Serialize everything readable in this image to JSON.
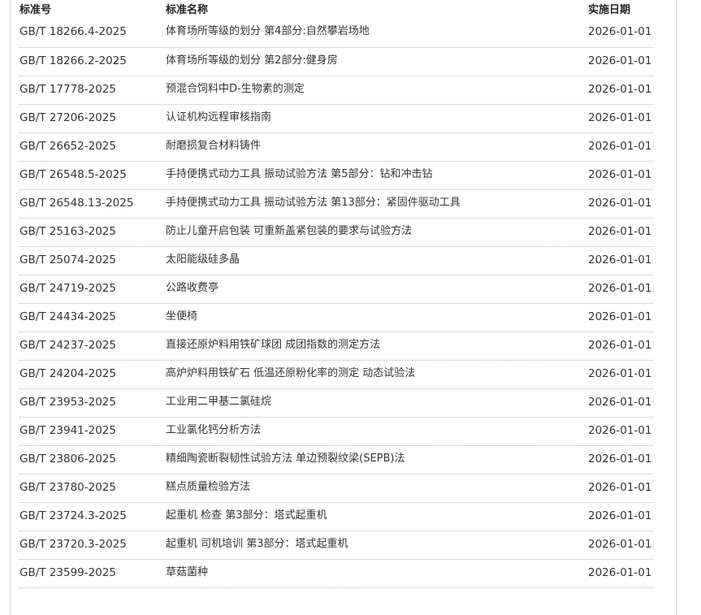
{
  "table": {
    "headers": {
      "code": "标准号",
      "name": "标准名称",
      "date": "实施日期"
    },
    "rows": [
      {
        "code": "GB/T 18266.4-2025",
        "name": "体育场所等级的划分 第4部分:自然攀岩场地",
        "date": "2026-01-01"
      },
      {
        "code": "GB/T 18266.2-2025",
        "name": "体育场所等级的划分 第2部分:健身房",
        "date": "2026-01-01"
      },
      {
        "code": "GB/T 17778-2025",
        "name": "预混合饲料中D-生物素的测定",
        "date": "2026-01-01"
      },
      {
        "code": "GB/T 27206-2025",
        "name": "认证机构远程审核指南",
        "date": "2026-01-01"
      },
      {
        "code": "GB/T 26652-2025",
        "name": "耐磨损复合材料铸件",
        "date": "2026-01-01"
      },
      {
        "code": "GB/T 26548.5-2025",
        "name": "手持便携式动力工具 振动试验方法 第5部分：钻和冲击钻",
        "date": "2026-01-01"
      },
      {
        "code": "GB/T 26548.13-2025",
        "name": "手持便携式动力工具 振动试验方法 第13部分：紧固件驱动工具",
        "date": "2026-01-01"
      },
      {
        "code": "GB/T 25163-2025",
        "name": "防止儿童开启包装 可重新盖紧包装的要求与试验方法",
        "date": "2026-01-01"
      },
      {
        "code": "GB/T 25074-2025",
        "name": "太阳能级硅多晶",
        "date": "2026-01-01"
      },
      {
        "code": "GB/T 24719-2025",
        "name": "公路收费亭",
        "date": "2026-01-01"
      },
      {
        "code": "GB/T 24434-2025",
        "name": "坐便椅",
        "date": "2026-01-01"
      },
      {
        "code": "GB/T 24237-2025",
        "name": "直接还原炉料用铁矿球团 成团指数的测定方法",
        "date": "2026-01-01"
      },
      {
        "code": "GB/T 24204-2025",
        "name": "高炉炉料用铁矿石 低温还原粉化率的测定 动态试验法",
        "date": "2026-01-01"
      },
      {
        "code": "GB/T 23953-2025",
        "name": "工业用二甲基二氯硅烷",
        "date": "2026-01-01"
      },
      {
        "code": "GB/T 23941-2025",
        "name": "工业氯化钙分析方法",
        "date": "2026-01-01"
      },
      {
        "code": "GB/T 23806-2025",
        "name": "精细陶瓷断裂韧性试验方法 单边预裂纹梁(SEPB)法",
        "date": "2026-01-01"
      },
      {
        "code": "GB/T 23780-2025",
        "name": "糕点质量检验方法",
        "date": "2026-01-01"
      },
      {
        "code": "GB/T 23724.3-2025",
        "name": "起重机 检查 第3部分：塔式起重机",
        "date": "2026-01-01"
      },
      {
        "code": "GB/T 23720.3-2025",
        "name": "起重机 司机培训 第3部分：塔式起重机",
        "date": "2026-01-01"
      },
      {
        "code": "GB/T 23599-2025",
        "name": "草菇菌种",
        "date": "2026-01-01"
      }
    ]
  }
}
